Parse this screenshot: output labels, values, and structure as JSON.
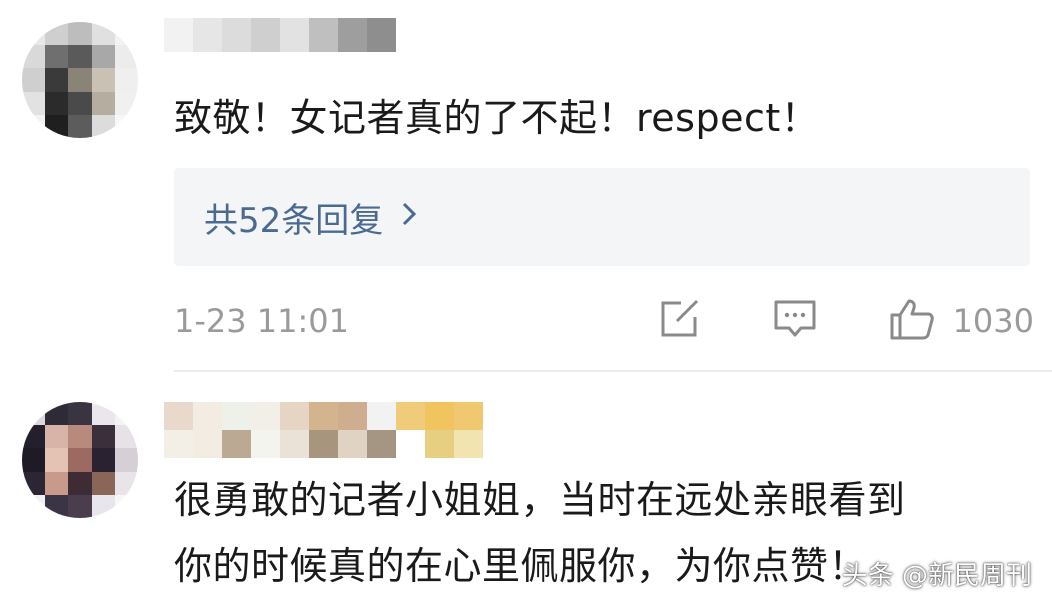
{
  "comments": [
    {
      "text": "致敬！女记者真的了不起！respect！",
      "reply_link": "共52条回复",
      "time": "1-23 11:01",
      "like_count": "1030"
    },
    {
      "text_line1": "很勇敢的记者小姐姐，当时在远处亲眼看到",
      "text_line2": "你的时候真的在心里佩服你，为你点赞！"
    }
  ],
  "watermark": "头条 @新民周刊",
  "icons": {
    "forward": "share-square-icon",
    "comment": "comment-bubble-icon",
    "like": "thumbs-up-icon",
    "reply_chevron": "chevron-right-icon"
  },
  "colors": {
    "reply_link": "#4a6a92",
    "reply_bg": "#f4f5f7",
    "meta_text": "#9a9a9a"
  }
}
